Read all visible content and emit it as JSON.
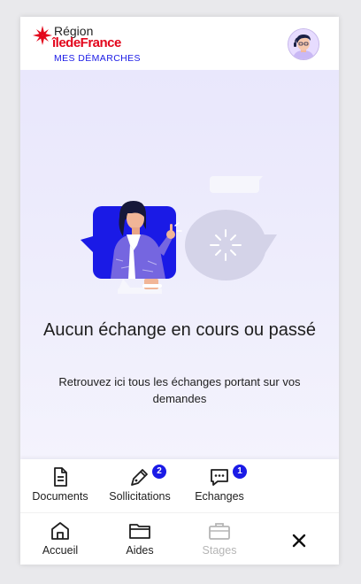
{
  "header": {
    "logo_line1": "Région",
    "logo_line2": "îledeFrance",
    "subtitle": "MES DÉMARCHES",
    "avatar_icon": "user-avatar"
  },
  "empty_state": {
    "title": "Aucun échange en cours ou passé",
    "description": "Retrouvez ici tous les échanges portant sur vos demandes"
  },
  "quick_actions": [
    {
      "label": "Documents",
      "icon": "document-icon"
    },
    {
      "label": "Sollicitations",
      "icon": "pen-icon",
      "badge": "2"
    },
    {
      "label": "Echanges",
      "icon": "chat-icon",
      "badge": "1"
    }
  ],
  "bottom_nav": [
    {
      "label": "Accueil",
      "icon": "home-icon"
    },
    {
      "label": "Aides",
      "icon": "folder-icon"
    },
    {
      "label": "Stages",
      "icon": "briefcase-icon",
      "disabled": true
    },
    {
      "label": "",
      "icon": "close-icon"
    }
  ],
  "colors": {
    "brand_blue": "#1a1ae6",
    "brand_red": "#e3051b",
    "content_bg": "#eceafc",
    "disabled": "#b5b5b5"
  }
}
